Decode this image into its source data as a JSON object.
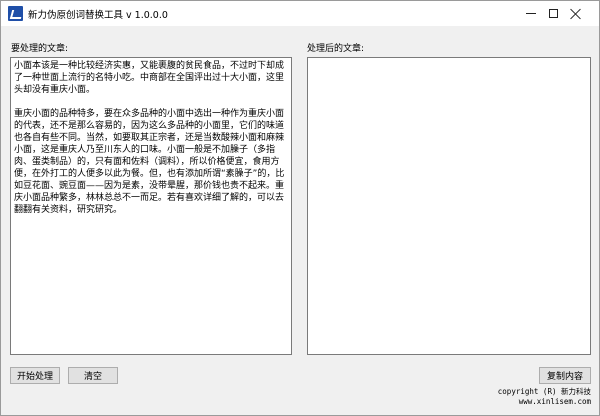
{
  "window": {
    "title": "新力伪原创词替换工具 v 1.0.0.0",
    "icon": "app-logo-icon",
    "controls": {
      "minimize": "minimize-icon",
      "maximize": "maximize-icon",
      "close": "close-icon"
    }
  },
  "input_panel": {
    "label": "要处理的文章:",
    "text": "小面本该是一种比较经济实惠，又能裹腹的贫民食品，不过时下却成了一种世面上流行的名特小吃。中商部在全国评出过十大小面，这里头却没有重庆小面。\n\n重庆小面的品种特多，要在众多品种的小面中选出一种作为重庆小面的代表，还不是那么容易的，因为这么多品种的小面里，它们的味道也各自有些不同。当然，如要取其正宗者，还是当数酸辣小面和麻辣小面，这是重庆人乃至川东人的口味。小面一般是不加臊子（多指肉、蛋类制品）的，只有面和佐料（调料），所以价格便宜，食用方便，在外打工的人便多以此为餐。但，也有添加所谓“素臊子”的，比如豆花面、豌豆面——因为是素，没带晕腥，那价钱也贵不起来。重庆小面品种繁多，林林总总不一而足。若有喜欢详细了解的，可以去翻翻有关资料，研究研究。"
  },
  "output_panel": {
    "label": "处理后的文章:",
    "text": ""
  },
  "buttons": {
    "start": "开始处理",
    "clear": "清空",
    "copy": "复制内容"
  },
  "footer": {
    "copyright": "copyright (R) 新力科技",
    "website": "www.xinlisem.com"
  }
}
